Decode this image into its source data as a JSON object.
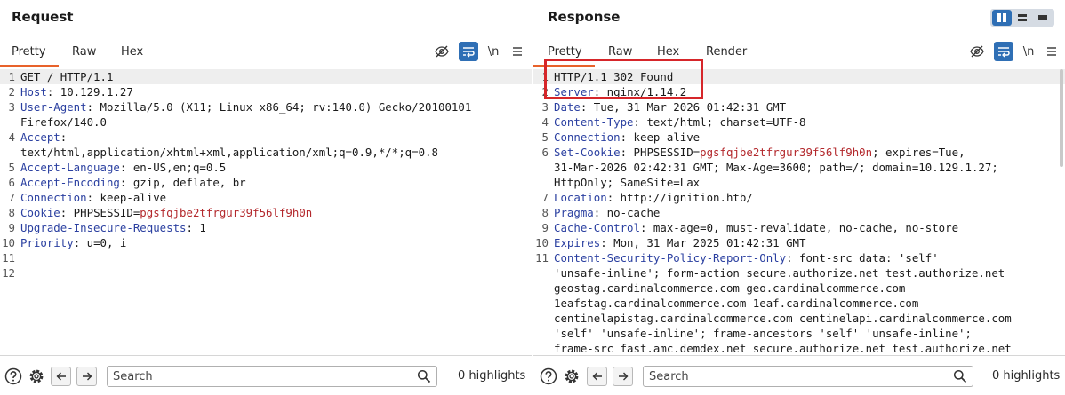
{
  "request": {
    "title": "Request",
    "tabs": [
      "Pretty",
      "Raw",
      "Hex"
    ],
    "active_tab": "Pretty",
    "tool_icons": [
      "eye-slash-icon",
      "wrap-icon",
      "newline-icon",
      "menu-icon"
    ],
    "newline_label": "\\n",
    "lines": [
      {
        "n": "1",
        "segments": [
          {
            "t": "GET / HTTP/1.1",
            "k": "plain"
          }
        ]
      },
      {
        "n": "2",
        "segments": [
          {
            "t": "Host",
            "k": "name"
          },
          {
            "t": ": 10.129.1.27",
            "k": "plain"
          }
        ]
      },
      {
        "n": "3",
        "segments": [
          {
            "t": "User-Agent",
            "k": "name"
          },
          {
            "t": ": Mozilla/5.0 (X11; Linux x86_64; rv:140.0) Gecko/20100101",
            "k": "plain"
          }
        ]
      },
      {
        "n": "",
        "segments": [
          {
            "t": "Firefox/140.0",
            "k": "plain"
          }
        ]
      },
      {
        "n": "4",
        "segments": [
          {
            "t": "Accept",
            "k": "name"
          },
          {
            "t": ":",
            "k": "plain"
          }
        ]
      },
      {
        "n": "",
        "segments": [
          {
            "t": "text/html,application/xhtml+xml,application/xml;q=0.9,*/*;q=0.8",
            "k": "plain"
          }
        ]
      },
      {
        "n": "5",
        "segments": [
          {
            "t": "Accept-Language",
            "k": "name"
          },
          {
            "t": ": en-US,en;q=0.5",
            "k": "plain"
          }
        ]
      },
      {
        "n": "6",
        "segments": [
          {
            "t": "Accept-Encoding",
            "k": "name"
          },
          {
            "t": ": gzip, deflate, br",
            "k": "plain"
          }
        ]
      },
      {
        "n": "7",
        "segments": [
          {
            "t": "Connection",
            "k": "name"
          },
          {
            "t": ": keep-alive",
            "k": "plain"
          }
        ]
      },
      {
        "n": "8",
        "segments": [
          {
            "t": "Cookie",
            "k": "name"
          },
          {
            "t": ": PHPSESSID=",
            "k": "plain"
          },
          {
            "t": "pgsfqjbe2tfrgur39f56lf9h0n",
            "k": "value"
          }
        ]
      },
      {
        "n": "9",
        "segments": [
          {
            "t": "Upgrade-Insecure-Requests",
            "k": "name"
          },
          {
            "t": ": 1",
            "k": "plain"
          }
        ]
      },
      {
        "n": "10",
        "segments": [
          {
            "t": "Priority",
            "k": "name"
          },
          {
            "t": ": u=0, i",
            "k": "plain"
          }
        ]
      },
      {
        "n": "11",
        "segments": []
      },
      {
        "n": "12",
        "segments": []
      }
    ],
    "search_placeholder": "Search",
    "highlights": "0 highlights"
  },
  "response": {
    "title": "Response",
    "tabs": [
      "Pretty",
      "Raw",
      "Hex",
      "Render"
    ],
    "active_tab": "Pretty",
    "newline_label": "\\n",
    "lines": [
      {
        "n": "1",
        "segments": [
          {
            "t": "HTTP/1.1 302 Found",
            "k": "plain"
          }
        ]
      },
      {
        "n": "2",
        "segments": [
          {
            "t": "Server",
            "k": "name"
          },
          {
            "t": ": nginx/1.14.2",
            "k": "plain"
          }
        ]
      },
      {
        "n": "3",
        "segments": [
          {
            "t": "Date",
            "k": "name"
          },
          {
            "t": ": Tue, 31 Mar 2026 01:42:31 GMT",
            "k": "plain"
          }
        ]
      },
      {
        "n": "4",
        "segments": [
          {
            "t": "Content-Type",
            "k": "name"
          },
          {
            "t": ": text/html; charset=UTF-8",
            "k": "plain"
          }
        ]
      },
      {
        "n": "5",
        "segments": [
          {
            "t": "Connection",
            "k": "name"
          },
          {
            "t": ": keep-alive",
            "k": "plain"
          }
        ]
      },
      {
        "n": "6",
        "segments": [
          {
            "t": "Set-Cookie",
            "k": "name"
          },
          {
            "t": ": PHPSESSID=",
            "k": "plain"
          },
          {
            "t": "pgsfqjbe2tfrgur39f56lf9h0n",
            "k": "value"
          },
          {
            "t": "; expires=Tue,",
            "k": "plain"
          }
        ]
      },
      {
        "n": "",
        "segments": [
          {
            "t": "31-Mar-2026 02:42:31 GMT; Max-Age=3600; path=/; domain=10.129.1.27;",
            "k": "plain"
          }
        ]
      },
      {
        "n": "",
        "segments": [
          {
            "t": "HttpOnly; SameSite=Lax",
            "k": "plain"
          }
        ]
      },
      {
        "n": "7",
        "segments": [
          {
            "t": "Location",
            "k": "name"
          },
          {
            "t": ": http://ignition.htb/",
            "k": "plain"
          }
        ]
      },
      {
        "n": "8",
        "segments": [
          {
            "t": "Pragma",
            "k": "name"
          },
          {
            "t": ": no-cache",
            "k": "plain"
          }
        ]
      },
      {
        "n": "9",
        "segments": [
          {
            "t": "Cache-Control",
            "k": "name"
          },
          {
            "t": ": max-age=0, must-revalidate, no-cache, no-store",
            "k": "plain"
          }
        ]
      },
      {
        "n": "10",
        "segments": [
          {
            "t": "Expires",
            "k": "name"
          },
          {
            "t": ": Mon, 31 Mar 2025 01:42:31 GMT",
            "k": "plain"
          }
        ]
      },
      {
        "n": "11",
        "segments": [
          {
            "t": "Content-Security-Policy-Report-Only",
            "k": "name"
          },
          {
            "t": ": font-src data: 'self'",
            "k": "plain"
          }
        ]
      },
      {
        "n": "",
        "segments": [
          {
            "t": "'unsafe-inline'; form-action secure.authorize.net test.authorize.net",
            "k": "plain"
          }
        ]
      },
      {
        "n": "",
        "segments": [
          {
            "t": "geostag.cardinalcommerce.com geo.cardinalcommerce.com",
            "k": "plain"
          }
        ]
      },
      {
        "n": "",
        "segments": [
          {
            "t": "1eafstag.cardinalcommerce.com 1eaf.cardinalcommerce.com",
            "k": "plain"
          }
        ]
      },
      {
        "n": "",
        "segments": [
          {
            "t": "centinelapistag.cardinalcommerce.com centinelapi.cardinalcommerce.com",
            "k": "plain"
          }
        ]
      },
      {
        "n": "",
        "segments": [
          {
            "t": "'self' 'unsafe-inline'; frame-ancestors 'self' 'unsafe-inline';",
            "k": "plain"
          }
        ]
      },
      {
        "n": "",
        "segments": [
          {
            "t": "frame-src fast.amc.demdex.net secure.authorize.net test.authorize.net",
            "k": "plain"
          }
        ]
      }
    ],
    "search_placeholder": "Search",
    "highlights": "0 highlights"
  },
  "colors": {
    "accent": "#e8622b",
    "active_icon": "#2f6fb5",
    "header_name": "#2a3fa0",
    "cookie_value": "#b3282c",
    "annotation_box": "#d6262a"
  }
}
